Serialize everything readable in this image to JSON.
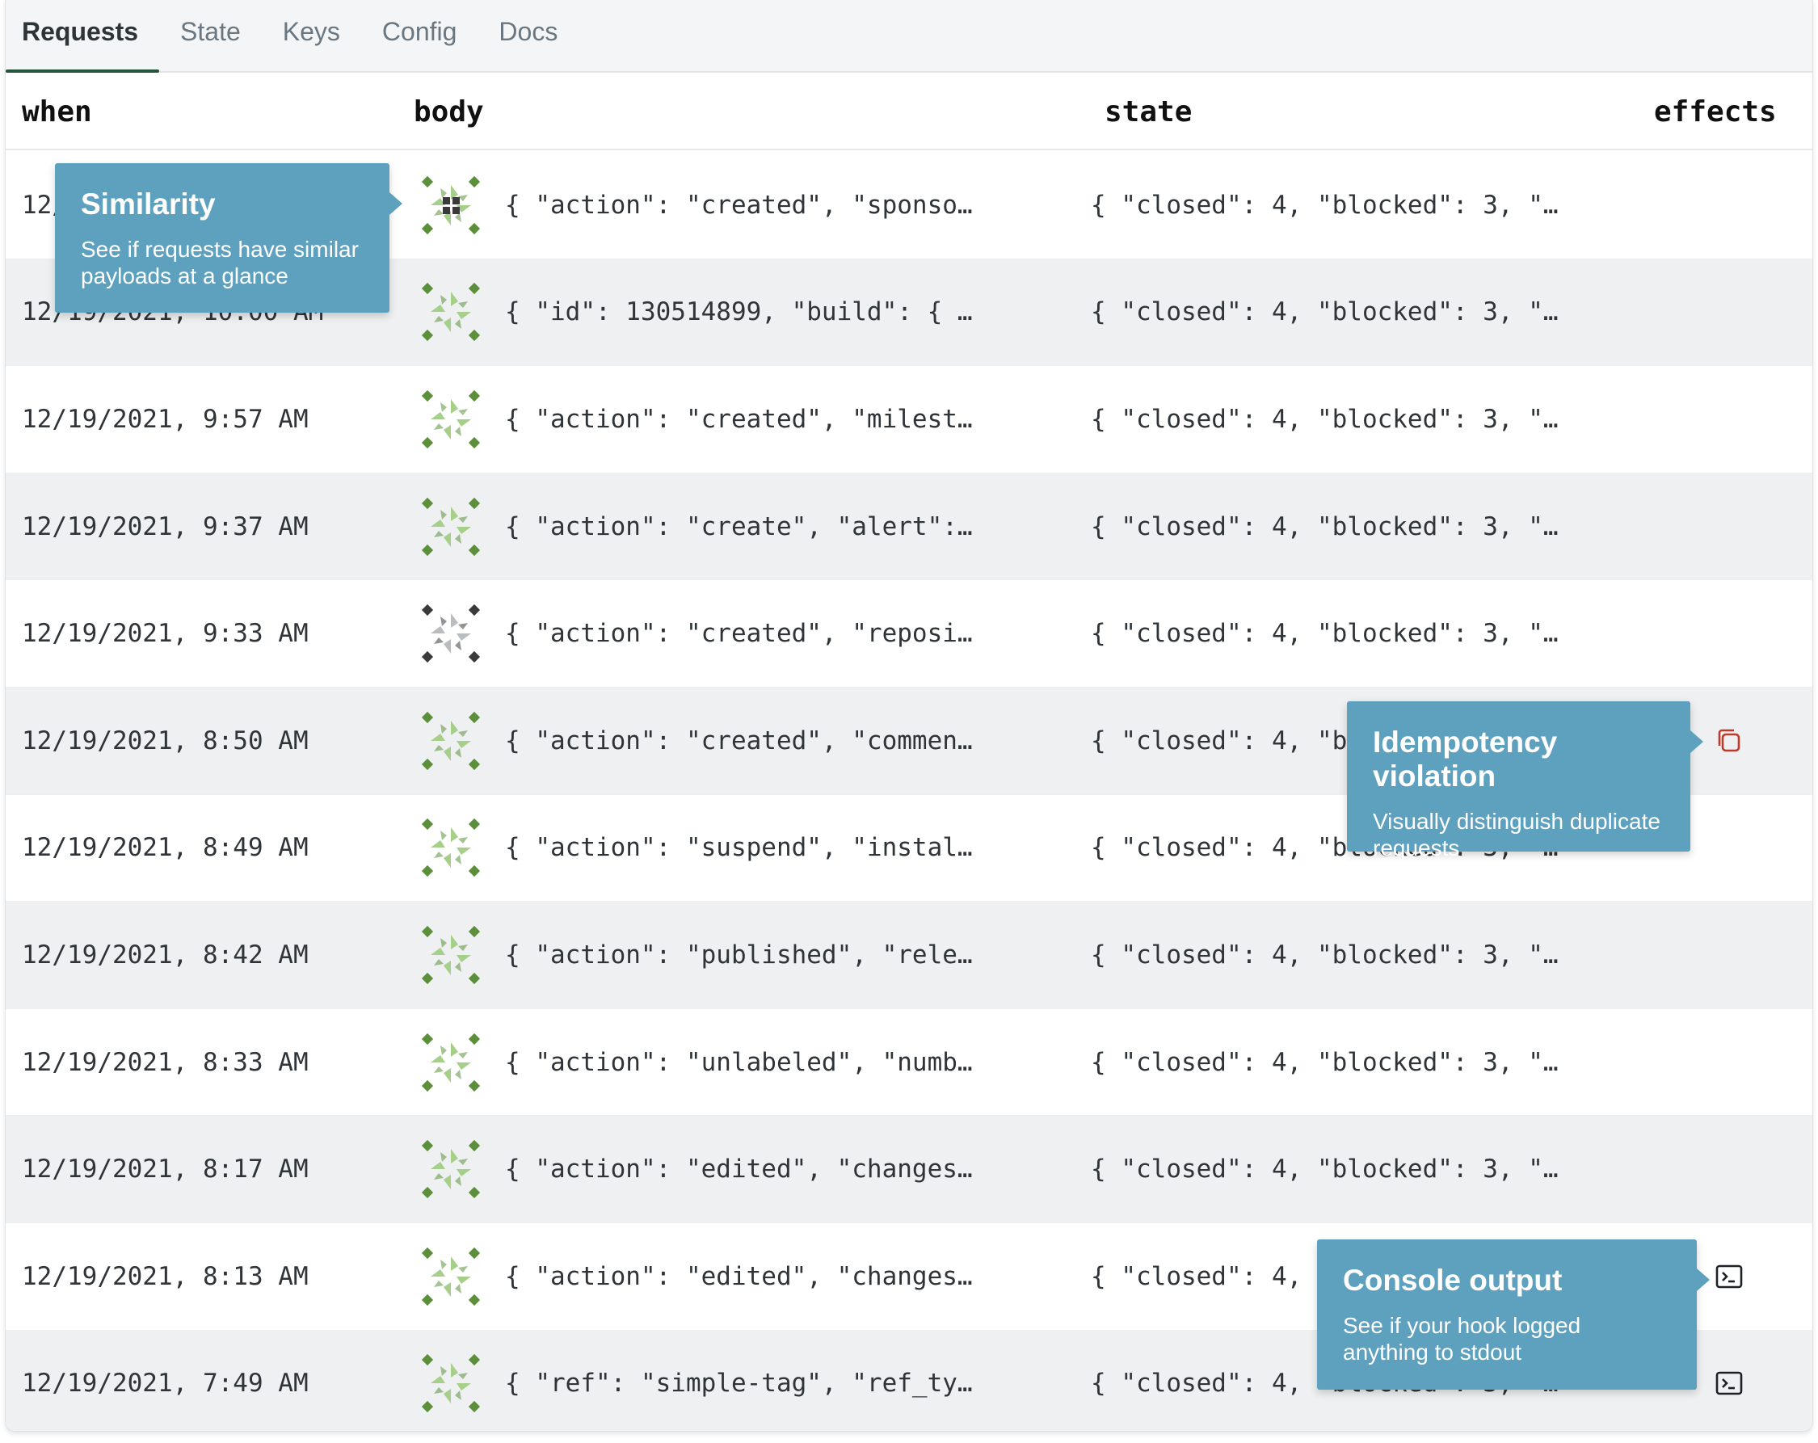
{
  "tabs": [
    {
      "label": "Requests",
      "active": true
    },
    {
      "label": "State",
      "active": false
    },
    {
      "label": "Keys",
      "active": false
    },
    {
      "label": "Config",
      "active": false
    },
    {
      "label": "Docs",
      "active": false
    }
  ],
  "columns": {
    "when": "when",
    "body": "body",
    "state": "state",
    "effects": "effects"
  },
  "colors": {
    "accent_tab": "#24543a",
    "glyph_green": "#5b8f3a",
    "glyph_light": "#a6cf8a",
    "glyph_dark": "#3a3a3a",
    "callout": "#5ea1bf",
    "effect_red": "#c0392b"
  },
  "rows": [
    {
      "when": "12/19/2021, 10:04 AM",
      "body": "{ \"action\": \"created\", \"sponso…",
      "state": "{ \"closed\": 4, \"blocked\": 3, \"…",
      "effect": null,
      "glyph": "dark-grid"
    },
    {
      "when": "12/19/2021, 10:00 AM",
      "body": "{ \"id\": 130514899, \"build\": { …",
      "state": "{ \"closed\": 4, \"blocked\": 3, \"…",
      "effect": null,
      "glyph": "green"
    },
    {
      "when": "12/19/2021, 9:57 AM",
      "body": "{ \"action\": \"created\", \"milest…",
      "state": "{ \"closed\": 4, \"blocked\": 3, \"…",
      "effect": null,
      "glyph": "green"
    },
    {
      "when": "12/19/2021, 9:37 AM",
      "body": "{ \"action\": \"create\", \"alert\":…",
      "state": "{ \"closed\": 4, \"blocked\": 3, \"…",
      "effect": null,
      "glyph": "green"
    },
    {
      "when": "12/19/2021, 9:33 AM",
      "body": "{ \"action\": \"created\", \"reposi…",
      "state": "{ \"closed\": 4, \"blocked\": 3, \"…",
      "effect": null,
      "glyph": "dark"
    },
    {
      "when": "12/19/2021, 8:50 AM",
      "body": "{ \"action\": \"created\", \"commen…",
      "state": "{ \"closed\": 4, \"blocked\": 3, \"…",
      "effect": "duplicate-icon",
      "glyph": "green"
    },
    {
      "when": "12/19/2021, 8:49 AM",
      "body": "{ \"action\": \"suspend\", \"instal…",
      "state": "{ \"closed\": 4, \"blocked\": 3, \"…",
      "effect": null,
      "glyph": "green"
    },
    {
      "when": "12/19/2021, 8:42 AM",
      "body": "{ \"action\": \"published\", \"rele…",
      "state": "{ \"closed\": 4, \"blocked\": 3, \"…",
      "effect": null,
      "glyph": "green"
    },
    {
      "when": "12/19/2021, 8:33 AM",
      "body": "{ \"action\": \"unlabeled\", \"numb…",
      "state": "{ \"closed\": 4, \"blocked\": 3, \"…",
      "effect": null,
      "glyph": "green"
    },
    {
      "when": "12/19/2021, 8:17 AM",
      "body": "{ \"action\": \"edited\", \"changes…",
      "state": "{ \"closed\": 4, \"blocked\": 3, \"…",
      "effect": null,
      "glyph": "green"
    },
    {
      "when": "12/19/2021, 8:13 AM",
      "body": "{ \"action\": \"edited\", \"changes…",
      "state": "{ \"closed\": 4, \"blocked\": 3, \"…",
      "effect": "terminal-icon",
      "glyph": "green"
    },
    {
      "when": "12/19/2021, 7:49 AM",
      "body": "{ \"ref\": \"simple-tag\", \"ref_ty…",
      "state": "{ \"closed\": 4, \"blocked\": 3, \"…",
      "effect": "terminal-icon",
      "glyph": "green"
    }
  ],
  "callouts": {
    "similarity": {
      "title": "Similarity",
      "desc": "See if requests have similar payloads at a glance"
    },
    "idempotency": {
      "title": "Idempotency violation",
      "desc": "Visually distinguish duplicate requests"
    },
    "console": {
      "title": "Console output",
      "desc": "See if your hook logged anything to stdout"
    }
  }
}
